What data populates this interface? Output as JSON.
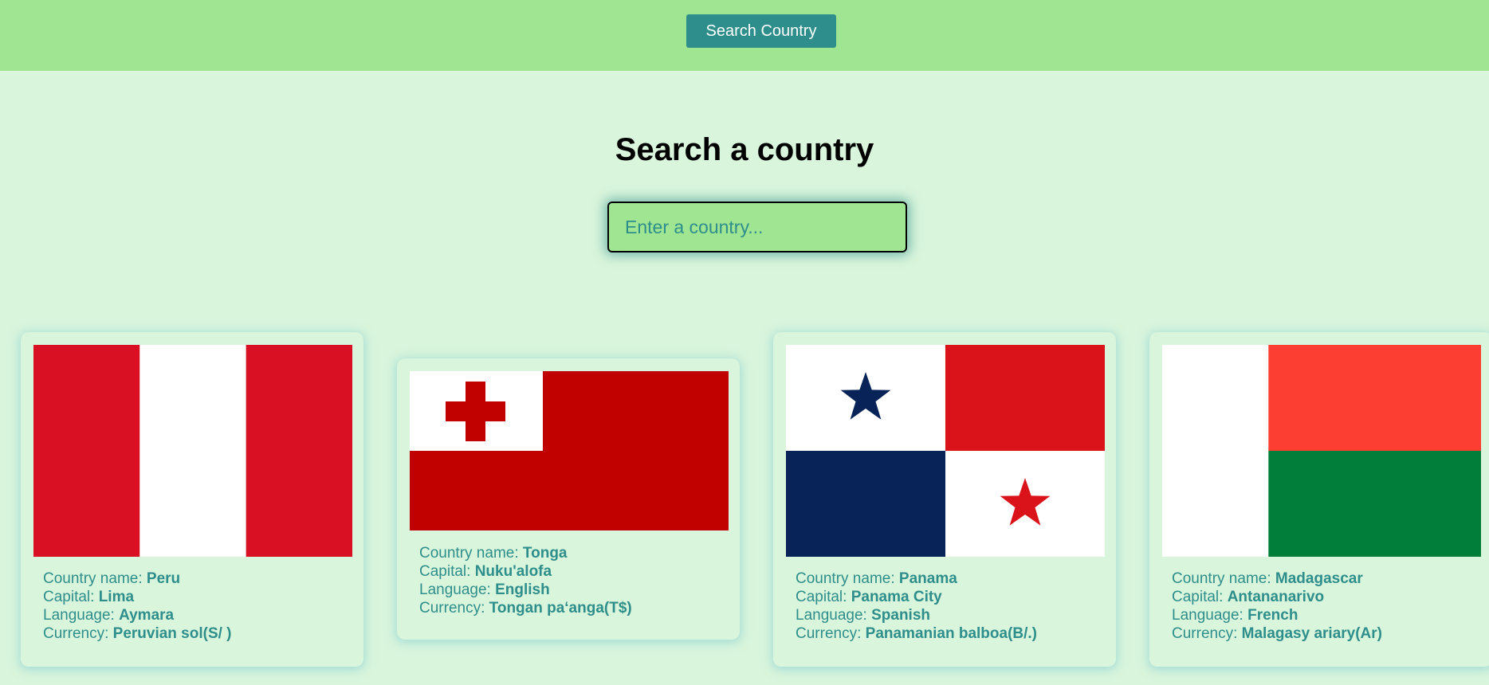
{
  "header": {
    "search_button_label": "Search Country"
  },
  "main": {
    "heading": "Search a country",
    "search_placeholder": "Enter a country..."
  },
  "labels": {
    "country_name": "Country name: ",
    "capital": "Capital: ",
    "language": "Language: ",
    "currency": "Currency: "
  },
  "countries": [
    {
      "name": "Peru",
      "capital": "Lima",
      "language": "Aymara",
      "currency": "Peruvian sol(S/ )"
    },
    {
      "name": "Tonga",
      "capital": "Nuku'alofa",
      "language": "English",
      "currency": "Tongan paʻanga(T$)"
    },
    {
      "name": "Panama",
      "capital": "Panama City",
      "language": "Spanish",
      "currency": "Panamanian balboa(B/.)"
    },
    {
      "name": "Madagascar",
      "capital": "Antananarivo",
      "language": "French",
      "currency": "Malagasy ariary(Ar)"
    }
  ],
  "colors": {
    "header_bg": "#9fe592",
    "page_bg": "#d9f5dc",
    "accent": "#2e8e8b"
  }
}
